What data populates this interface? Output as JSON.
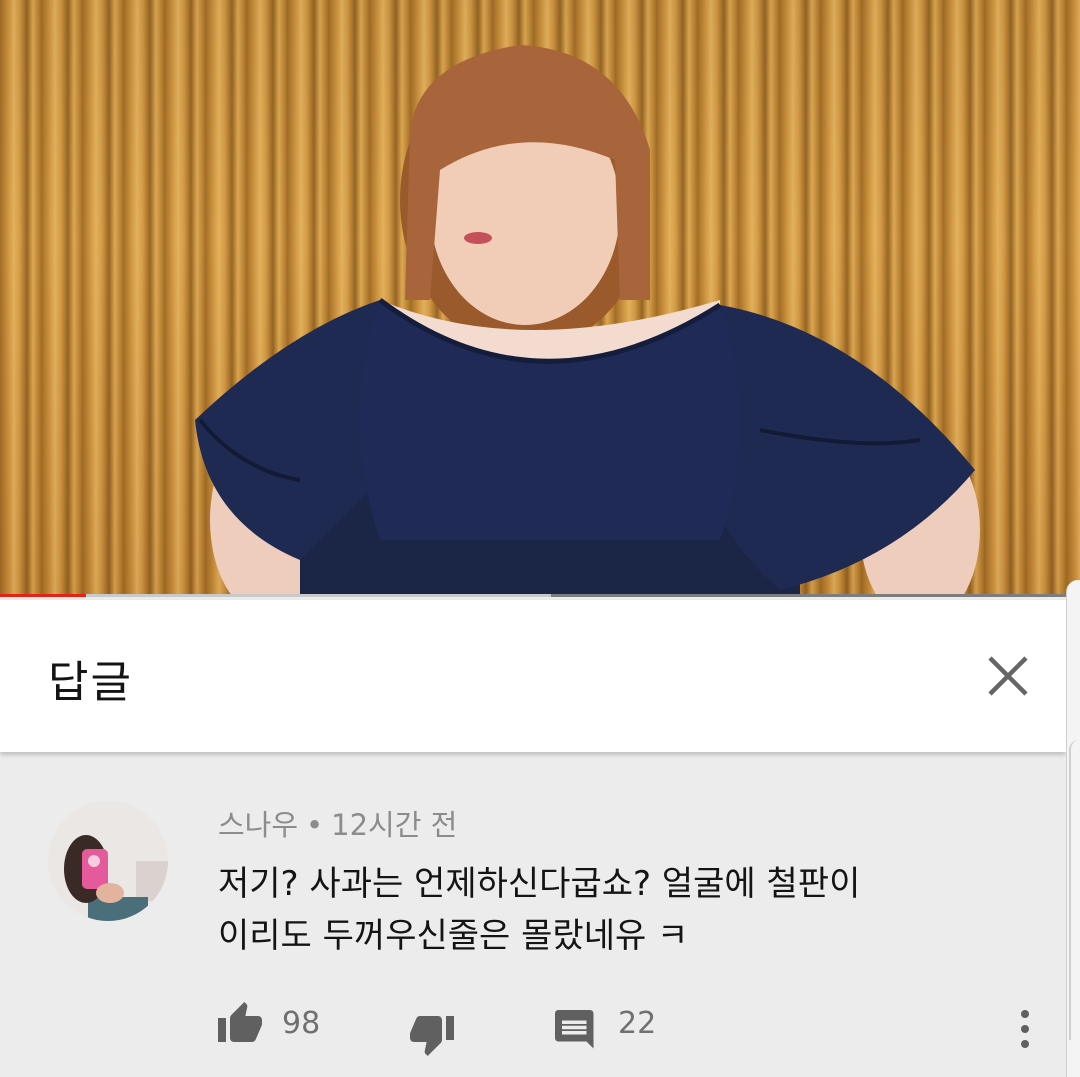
{
  "video": {
    "progress_played_fraction": 0.08,
    "progress_buffered_fraction": 0.51,
    "colors": {
      "played": "#e62117",
      "buffered": "#c9c9c9",
      "track": "#7d7d7d"
    }
  },
  "panel": {
    "title": "답글",
    "close_icon": "close-icon"
  },
  "comment": {
    "author": "스나우",
    "separator": "•",
    "time": "12시간 전",
    "text_lines": [
      "저기? 사과는 언제하신다굽쇼? 얼굴에 철판이",
      "이리도 두꺼우신줄은 몰랐네유 ㅋ"
    ],
    "likes": "98",
    "replies": "22",
    "icons": {
      "like": "thumbs-up-icon",
      "dislike": "thumbs-down-icon",
      "reply": "comment-icon",
      "more": "more-vertical-icon"
    }
  }
}
